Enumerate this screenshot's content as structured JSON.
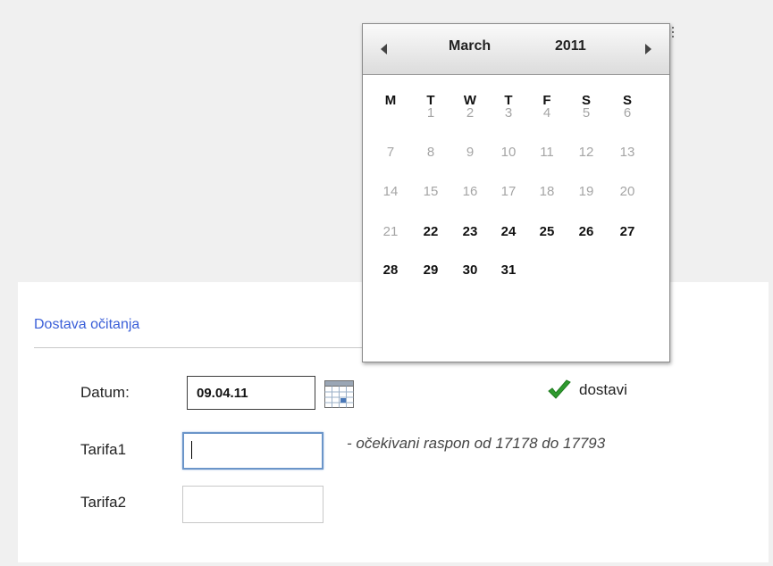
{
  "section": {
    "title": "Dostava očitanja"
  },
  "form": {
    "datum_label": "Datum:",
    "datum_value": "09.04.11",
    "tarifa1_label": "Tarifa1",
    "tarifa1_value": "",
    "tarifa2_label": "Tarifa2",
    "tarifa2_value": "",
    "hint": "- očekivani raspon od 17178 do 17793",
    "submit_label": "dostavi"
  },
  "calendar": {
    "month": "March",
    "year": "2011",
    "weekdays": [
      "M",
      "T",
      "W",
      "T",
      "F",
      "S",
      "S"
    ],
    "weeks": [
      [
        "",
        "1",
        "2",
        "3",
        "4",
        "5",
        "6"
      ],
      [
        "7",
        "8",
        "9",
        "10",
        "11",
        "12",
        "13"
      ],
      [
        "14",
        "15",
        "16",
        "17",
        "18",
        "19",
        "20"
      ],
      [
        "21",
        "22",
        "23",
        "24",
        "25",
        "26",
        "27"
      ],
      [
        "28",
        "29",
        "30",
        "31",
        "",
        "",
        ""
      ]
    ],
    "first_selectable_day": 22
  },
  "colors": {
    "accent": "#3a5fd8",
    "check": "#2e9a2e",
    "disabled_day": "#a5a5a5",
    "focus_border": "#6b95c9"
  },
  "icons": {
    "prev": "triangle-left-icon",
    "next": "triangle-right-icon",
    "calendar": "calendar-icon",
    "submit": "checkmark-icon"
  }
}
